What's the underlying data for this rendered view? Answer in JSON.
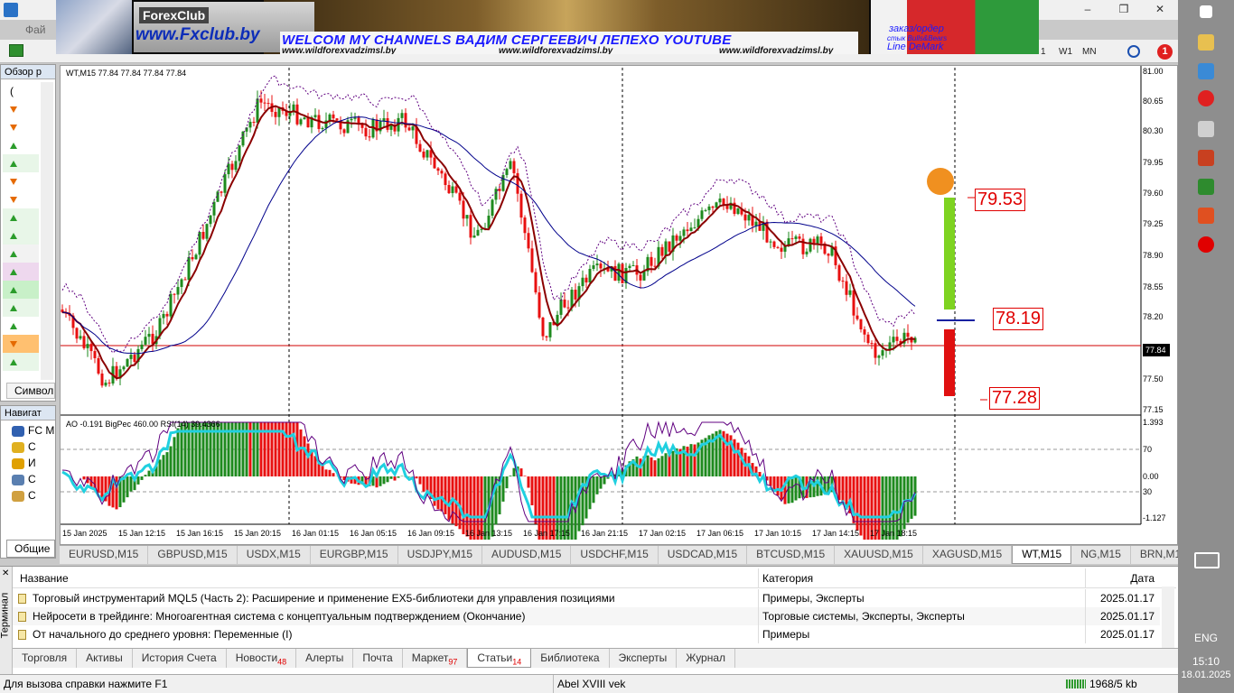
{
  "app": {
    "menu_file": "Фай",
    "window_controls": [
      "–",
      "❒",
      "✕"
    ]
  },
  "banner": {
    "brand": "ForexClub",
    "url": "www.Fxclub.by",
    "welcome": "WELCOM MY CHANNELS ВАДИМ СЕРГЕЕВИЧ ЛЕПЕХО YOUTUBE",
    "sites": [
      "www.wildforexvadzimsl.by",
      "www.wildforexvadzimsl.by",
      "www.wildforexvadzimsl.by"
    ],
    "order": "заказ/ордер",
    "bulls": "стык Bulls&Bears",
    "demark": "Line DeMark"
  },
  "toolbar": {
    "timeframes": [
      "1",
      "W1",
      "MN"
    ],
    "notifications": "1"
  },
  "market_watch": {
    "title": "Обзор р",
    "first_row": "(",
    "rows": [
      "dn",
      "dn",
      "up",
      "up",
      "dn",
      "dn",
      "up",
      "up",
      "up",
      "up",
      "up",
      "up",
      "up",
      "dn",
      "up"
    ],
    "symbol_tab": "Символ"
  },
  "navigator": {
    "title": "Навигат",
    "root": "FC M",
    "items": [
      "С",
      "И",
      "С",
      "С"
    ],
    "tab": "Общие"
  },
  "chart": {
    "header": "WT,M15  77.84 77.84 77.84 77.84",
    "sub_header": "AO -0.191  BigPec 460.00  RSI(14) 39.4366",
    "price_scale": [
      "81.00",
      "80.65",
      "80.30",
      "79.95",
      "79.60",
      "79.25",
      "78.90",
      "78.55",
      "78.20",
      "77.50",
      "77.15"
    ],
    "sub_scale": [
      "1.393",
      "70",
      "0.00",
      "30",
      "-1.127"
    ],
    "current_price": "77.84",
    "time_labels": [
      "15 Jan 2025",
      "15 Jan 12:15",
      "15 Jan 16:15",
      "15 Jan 20:15",
      "16 Jan 01:15",
      "16 Jan 05:15",
      "16 Jan 09:15",
      "16 Jan 13:15",
      "16 Jan 17:15",
      "16 Jan 21:15",
      "17 Jan 02:15",
      "17 Jan 06:15",
      "17 Jan 10:15",
      "17 Jan 14:15",
      "17 Jan 18:15"
    ],
    "levels": {
      "upper": "79.53",
      "middle": "78.19",
      "lower": "77.28"
    },
    "colors": {
      "bull": "#1e8a1e",
      "bear": "#e81010",
      "ma_fast": "#8b0000",
      "ma_slow": "#00008b",
      "rsi": "#20d0e0",
      "envelope": "#600080",
      "hline": "#d00000"
    }
  },
  "symbol_tabs": [
    "EURUSD,M15",
    "GBPUSD,M15",
    "USDX,M15",
    "EURGBP,M15",
    "USDJPY,M15",
    "AUDUSD,M15",
    "USDCHF,M15",
    "USDCAD,M15",
    "BTCUSD,M15",
    "XAUUSD,M15",
    "XAGUSD,M15",
    "WT,M15",
    "NG,M15",
    "BRN,M15"
  ],
  "symbol_tabs_active": "WT,M15",
  "terminal": {
    "side_label": "Терминал",
    "headers": {
      "name": "Название",
      "category": "Категория",
      "date": "Дата"
    },
    "rows": [
      {
        "name": "Торговый инструментарий MQL5 (Часть 2): Расширение и применение EX5-библиотеки для управления позициями",
        "category": "Примеры, Эксперты",
        "date": "2025.01.17"
      },
      {
        "name": "Нейросети в трейдинге: Многоагентная система с концептуальным подтверждением (Окончание)",
        "category": "Торговые системы, Эксперты, Эксперты",
        "date": "2025.01.17"
      },
      {
        "name": "От начального до среднего уровня: Переменные (I)",
        "category": "Примеры",
        "date": "2025.01.17"
      }
    ],
    "tabs": [
      {
        "label": "Торговля",
        "badge": ""
      },
      {
        "label": "Активы",
        "badge": ""
      },
      {
        "label": "История Счета",
        "badge": ""
      },
      {
        "label": "Новости",
        "badge": "48"
      },
      {
        "label": "Алерты",
        "badge": ""
      },
      {
        "label": "Почта",
        "badge": ""
      },
      {
        "label": "Маркет",
        "badge": "97"
      },
      {
        "label": "Статьи",
        "badge": "14"
      },
      {
        "label": "Библиотека",
        "badge": ""
      },
      {
        "label": "Эксперты",
        "badge": ""
      },
      {
        "label": "Журнал",
        "badge": ""
      }
    ],
    "active_tab": "Статьи"
  },
  "status": {
    "help": "Для вызова справки нажмите F1",
    "profile": "Abel XVIII vek",
    "traffic": "1968/5 kb"
  },
  "desktop": {
    "lang": "ENG",
    "time": "15:10",
    "date": "18.01.2025"
  }
}
